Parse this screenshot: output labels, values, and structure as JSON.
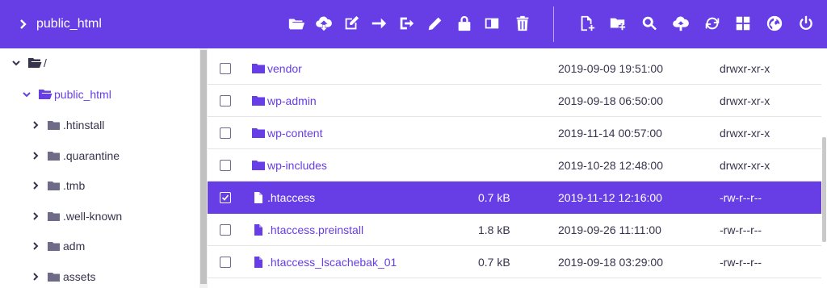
{
  "header": {
    "breadcrumb": "public_html",
    "toolbar_left": [
      "open-folder-icon",
      "cloud-download-icon",
      "edit-square-icon",
      "arrow-right-icon",
      "move-icon",
      "pencil-icon",
      "lock-icon",
      "archive-icon",
      "trash-icon"
    ],
    "toolbar_right": [
      "new-file-icon",
      "new-folder-icon",
      "search-icon",
      "cloud-upload-icon",
      "refresh-icon",
      "grid-view-icon",
      "globe-icon",
      "power-icon"
    ]
  },
  "sidebar": {
    "items": [
      {
        "label": "/",
        "level": 0,
        "expanded": true
      },
      {
        "label": "public_html",
        "level": 1,
        "expanded": true,
        "active": true
      },
      {
        "label": ".htinstall",
        "level": 2
      },
      {
        "label": ".quarantine",
        "level": 2
      },
      {
        "label": ".tmb",
        "level": 2
      },
      {
        "label": ".well-known",
        "level": 2
      },
      {
        "label": "adm",
        "level": 2
      },
      {
        "label": "assets",
        "level": 2
      }
    ]
  },
  "files": {
    "rows": [
      {
        "type": "folder",
        "name": "vendor",
        "size": "",
        "date": "2019-09-09 19:51:00",
        "perm": "drwxr-xr-x",
        "selected": false
      },
      {
        "type": "folder",
        "name": "wp-admin",
        "size": "",
        "date": "2019-09-18 06:50:00",
        "perm": "drwxr-xr-x",
        "selected": false
      },
      {
        "type": "folder",
        "name": "wp-content",
        "size": "",
        "date": "2019-11-14 00:57:00",
        "perm": "drwxr-xr-x",
        "selected": false
      },
      {
        "type": "folder",
        "name": "wp-includes",
        "size": "",
        "date": "2019-10-28 12:48:00",
        "perm": "drwxr-xr-x",
        "selected": false
      },
      {
        "type": "file",
        "name": ".htaccess",
        "size": "0.7 kB",
        "date": "2019-11-12 12:16:00",
        "perm": "-rw-r--r--",
        "selected": true
      },
      {
        "type": "file",
        "name": ".htaccess.preinstall",
        "size": "1.8 kB",
        "date": "2019-09-26 11:11:00",
        "perm": "-rw-r--r--",
        "selected": false
      },
      {
        "type": "file",
        "name": ".htaccess_lscachebak_01",
        "size": "0.7 kB",
        "date": "2019-09-18 03:29:00",
        "perm": "-rw-r--r--",
        "selected": false
      }
    ]
  },
  "colors": {
    "accent": "#673de6",
    "text": "#36344d",
    "folder_sidebar": "#6d6b87"
  }
}
